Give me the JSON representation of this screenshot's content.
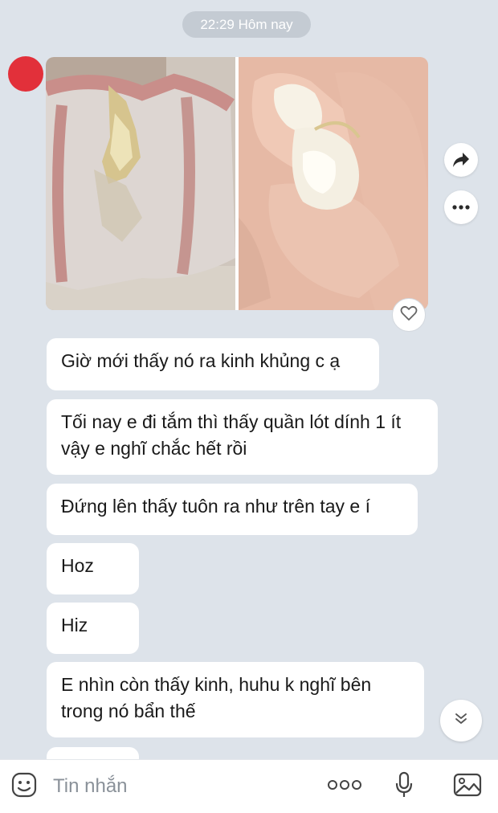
{
  "header": {
    "timestamp": "22:29 Hôm nay"
  },
  "media": {
    "photo_1_alt": "photo",
    "photo_2_alt": "photo"
  },
  "messages": [
    {
      "text": "Giờ mới thấy nó ra kinh khủng c ạ"
    },
    {
      "text": "Tối nay e đi tắm thì thấy quần lót dính 1 ít vậy e nghĩ chắc hết rồi"
    },
    {
      "text": "Đứng lên thấy tuôn ra như trên tay e í"
    },
    {
      "text": "Hoz"
    },
    {
      "text": "Hiz"
    },
    {
      "text": "E nhìn còn thấy kinh, huhu k nghĩ bên trong nó bẩn thế"
    }
  ],
  "input": {
    "placeholder": "Tin nhắn"
  },
  "icons": {
    "forward": "forward-arrow-icon",
    "more": "more-dots-icon",
    "react": "heart-icon",
    "scroll_down": "double-chevron-down-icon",
    "sticker": "sticker-face-icon",
    "more_options": "more-options-icon",
    "voice": "microphone-icon",
    "image": "image-icon"
  },
  "colors": {
    "background": "#dde3ea",
    "bubble": "#ffffff",
    "avatar": "#e2303a",
    "time_pill": "#c4cbd3",
    "icon": "#333333"
  }
}
